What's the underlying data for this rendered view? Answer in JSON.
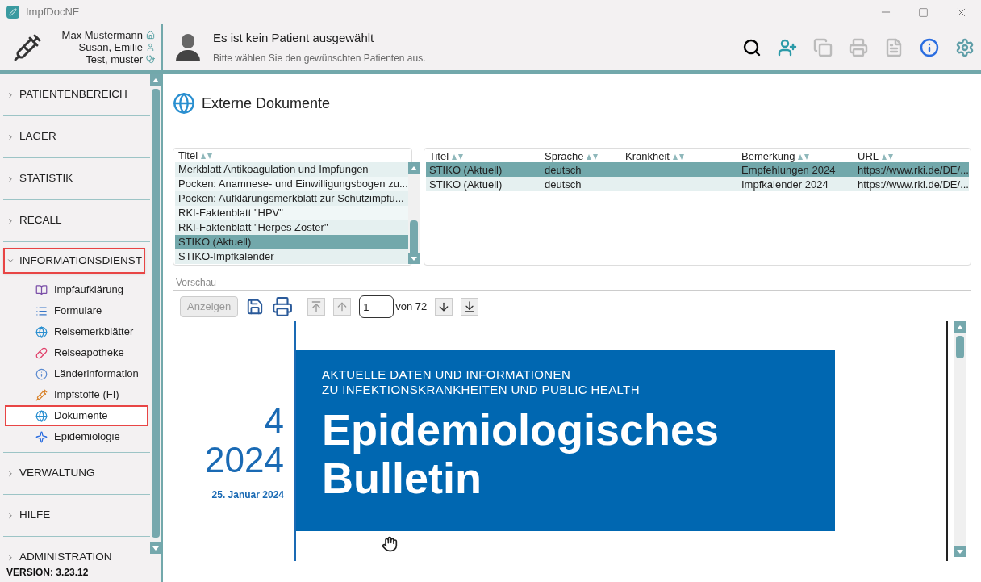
{
  "window": {
    "title": "ImpfDocNE"
  },
  "header": {
    "users": [
      {
        "name": "Max Mustermann",
        "kind": "home"
      },
      {
        "name": "Susan, Emilie",
        "kind": "person"
      },
      {
        "name": "Test, muster",
        "kind": "doctor"
      }
    ],
    "patient": {
      "title": "Es ist kein Patient ausgewählt",
      "subtitle": "Bitte wählen Sie den gewünschten Patienten aus."
    },
    "toolbar": [
      {
        "kind": "search",
        "disabled": false
      },
      {
        "kind": "add-patient",
        "disabled": false
      },
      {
        "kind": "copy",
        "disabled": true
      },
      {
        "kind": "print",
        "disabled": true
      },
      {
        "kind": "csv",
        "disabled": true
      },
      {
        "kind": "info",
        "disabled": false
      },
      {
        "kind": "settings",
        "disabled": false
      }
    ]
  },
  "sidebar": {
    "sections": [
      {
        "label": "PATIENTENBEREICH",
        "expanded": false,
        "highlighted": false
      },
      {
        "label": "LAGER",
        "expanded": false,
        "highlighted": false
      },
      {
        "label": "STATISTIK",
        "expanded": false,
        "highlighted": false
      },
      {
        "label": "RECALL",
        "expanded": false,
        "highlighted": false
      },
      {
        "label": "INFORMATIONSDIENST",
        "expanded": true,
        "highlighted": true,
        "children": [
          {
            "label": "Impfaufklärung",
            "kind": "book",
            "selected": false,
            "highlighted": false
          },
          {
            "label": "Formulare",
            "kind": "form",
            "selected": false,
            "highlighted": false
          },
          {
            "label": "Reisemerkblätter",
            "kind": "globe",
            "selected": false,
            "highlighted": false
          },
          {
            "label": "Reiseapotheke",
            "kind": "pill",
            "selected": false,
            "highlighted": false
          },
          {
            "label": "Länderinformation",
            "kind": "info",
            "selected": false,
            "highlighted": false
          },
          {
            "label": "Impfstoffe (FI)",
            "kind": "vaccine",
            "selected": false,
            "highlighted": false
          },
          {
            "label": "Dokumente",
            "kind": "document",
            "selected": true,
            "highlighted": true
          },
          {
            "label": "Epidemiologie",
            "kind": "star",
            "selected": false,
            "highlighted": false
          }
        ]
      },
      {
        "label": "VERWALTUNG",
        "expanded": false,
        "highlighted": false
      },
      {
        "label": "HILFE",
        "expanded": false,
        "highlighted": false
      },
      {
        "label": "ADMINISTRATION",
        "expanded": false,
        "highlighted": false
      }
    ],
    "version": "VERSION: 3.23.12"
  },
  "page": {
    "title": "Externe Dokumente",
    "document_list": {
      "column": "Titel",
      "rows": [
        {
          "title": "Merkblatt Antikoagulation und Impfungen",
          "selected": false
        },
        {
          "title": "Pocken: Anamnese- und Einwilligungsbogen zu...",
          "selected": false
        },
        {
          "title": "Pocken: Aufklärungsmerkblatt zur Schutzimpfu...",
          "selected": false
        },
        {
          "title": "RKI-Faktenblatt \"HPV\"",
          "selected": false
        },
        {
          "title": "RKI-Faktenblatt \"Herpes Zoster\"",
          "selected": false
        },
        {
          "title": "STIKO (Aktuell)",
          "selected": true
        },
        {
          "title": "STIKO-Impfkalender",
          "selected": false
        }
      ]
    },
    "table": {
      "columns": [
        "Titel",
        "Sprache",
        "Krankheit",
        "Bemerkung",
        "URL"
      ],
      "rows": [
        {
          "cells": [
            "STIKO (Aktuell)",
            "deutsch",
            "",
            "Empfehlungen 2024",
            "https://www.rki.de/DE/..."
          ],
          "selected": true
        },
        {
          "cells": [
            "STIKO (Aktuell)",
            "deutsch",
            "",
            "Impfkalender 2024",
            "https://www.rki.de/DE/..."
          ],
          "selected": false
        }
      ]
    },
    "preview": {
      "label": "Vorschau",
      "show_button": {
        "label": "Anzeigen",
        "disabled": true
      },
      "page_value": "1",
      "page_total": "von 72",
      "document": {
        "kicker": [
          "AKTUELLE DATEN UND INFORMATIONEN",
          "ZU INFEKTIONSKRANKHEITEN UND PUBLIC HEALTH"
        ],
        "title": [
          "Epidemiologisches",
          "Bulletin"
        ],
        "issue": "4",
        "year": "2024",
        "date": "25. Januar 2024"
      }
    }
  }
}
